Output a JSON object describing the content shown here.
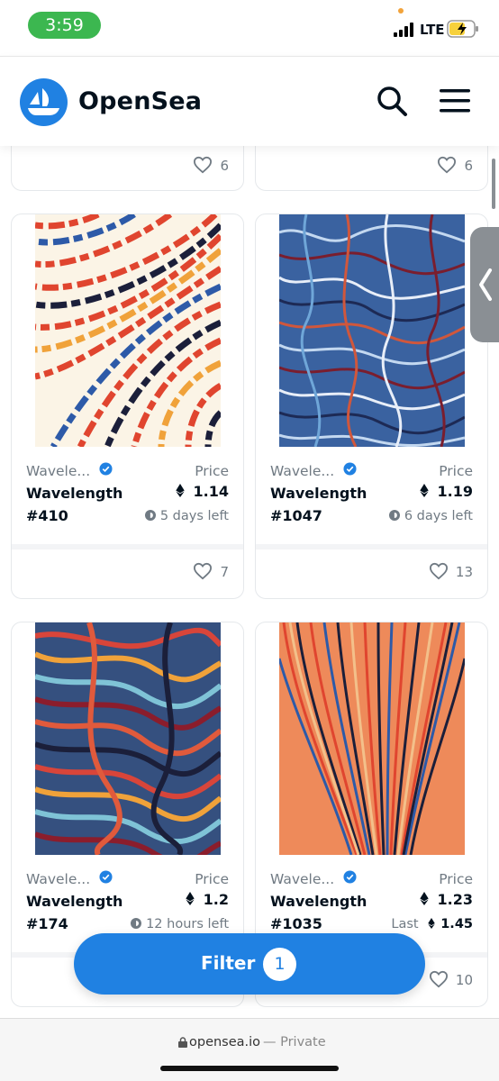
{
  "status": {
    "time": "3:59",
    "carrier": "LTE"
  },
  "header": {
    "brand": "OpenSea",
    "search_icon": "search-icon",
    "menu_icon": "hamburger-menu-icon"
  },
  "top_cards": [
    {
      "likes": "6"
    },
    {
      "likes": "6"
    }
  ],
  "cards": [
    {
      "collection": "Wavele...",
      "name": "Wavelength",
      "id": "#410",
      "price_label": "Price",
      "price": "1.14",
      "time_left": "5 days left",
      "likes": "7"
    },
    {
      "collection": "Wavele...",
      "name": "Wavelength",
      "id": "#1047",
      "price_label": "Price",
      "price": "1.19",
      "time_left": "6 days left",
      "likes": "13"
    },
    {
      "collection": "Wavele...",
      "name": "Wavelength",
      "id": "#174",
      "price_label": "Price",
      "price": "1.2",
      "time_left": "12 hours left",
      "likes": ""
    },
    {
      "collection": "Wavele...",
      "name": "Wavelength",
      "id": "#1035",
      "price_label": "Price",
      "price": "1.23",
      "last_label": "Last",
      "last_price": "1.45",
      "likes": "10"
    }
  ],
  "filter": {
    "label": "Filter",
    "count": "1"
  },
  "url_bar": {
    "domain": "opensea.io",
    "private": "— Private"
  },
  "colors": {
    "brand_blue": "#2081e2",
    "text_dark": "#04111d",
    "text_muted": "#707a83"
  }
}
